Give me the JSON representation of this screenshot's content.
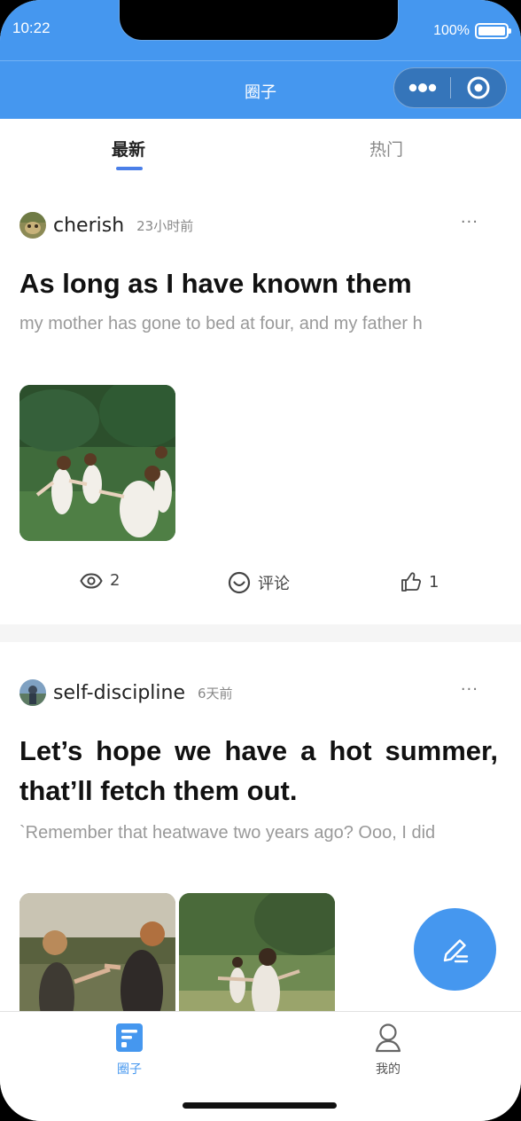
{
  "status_bar": {
    "time": "10:22",
    "battery": "100%"
  },
  "nav": {
    "title": "圈子"
  },
  "tabs": [
    {
      "label": "最新",
      "active": true
    },
    {
      "label": "热门",
      "active": false
    }
  ],
  "posts": [
    {
      "author": "cherish",
      "time": "23小时前",
      "more": "···",
      "title": "As long as I have known them",
      "body": "my mother has gone to bed at four, and my father h",
      "views": "2",
      "comment_label": "评论",
      "likes": "1"
    },
    {
      "author": "self-discipline",
      "time": "6天前",
      "more": "···",
      "title": "Let’s hope we have a hot summer, that’ll fetch them out.",
      "body": "`Remember that heatwave two years ago? Ooo, I did"
    }
  ],
  "tabbar": [
    {
      "label": "圈子",
      "active": true
    },
    {
      "label": "我的",
      "active": false
    }
  ],
  "colors": {
    "primary": "#4597ef",
    "tab_indicator": "#4b7fe8",
    "text_main": "#222222",
    "text_muted": "#999999"
  }
}
